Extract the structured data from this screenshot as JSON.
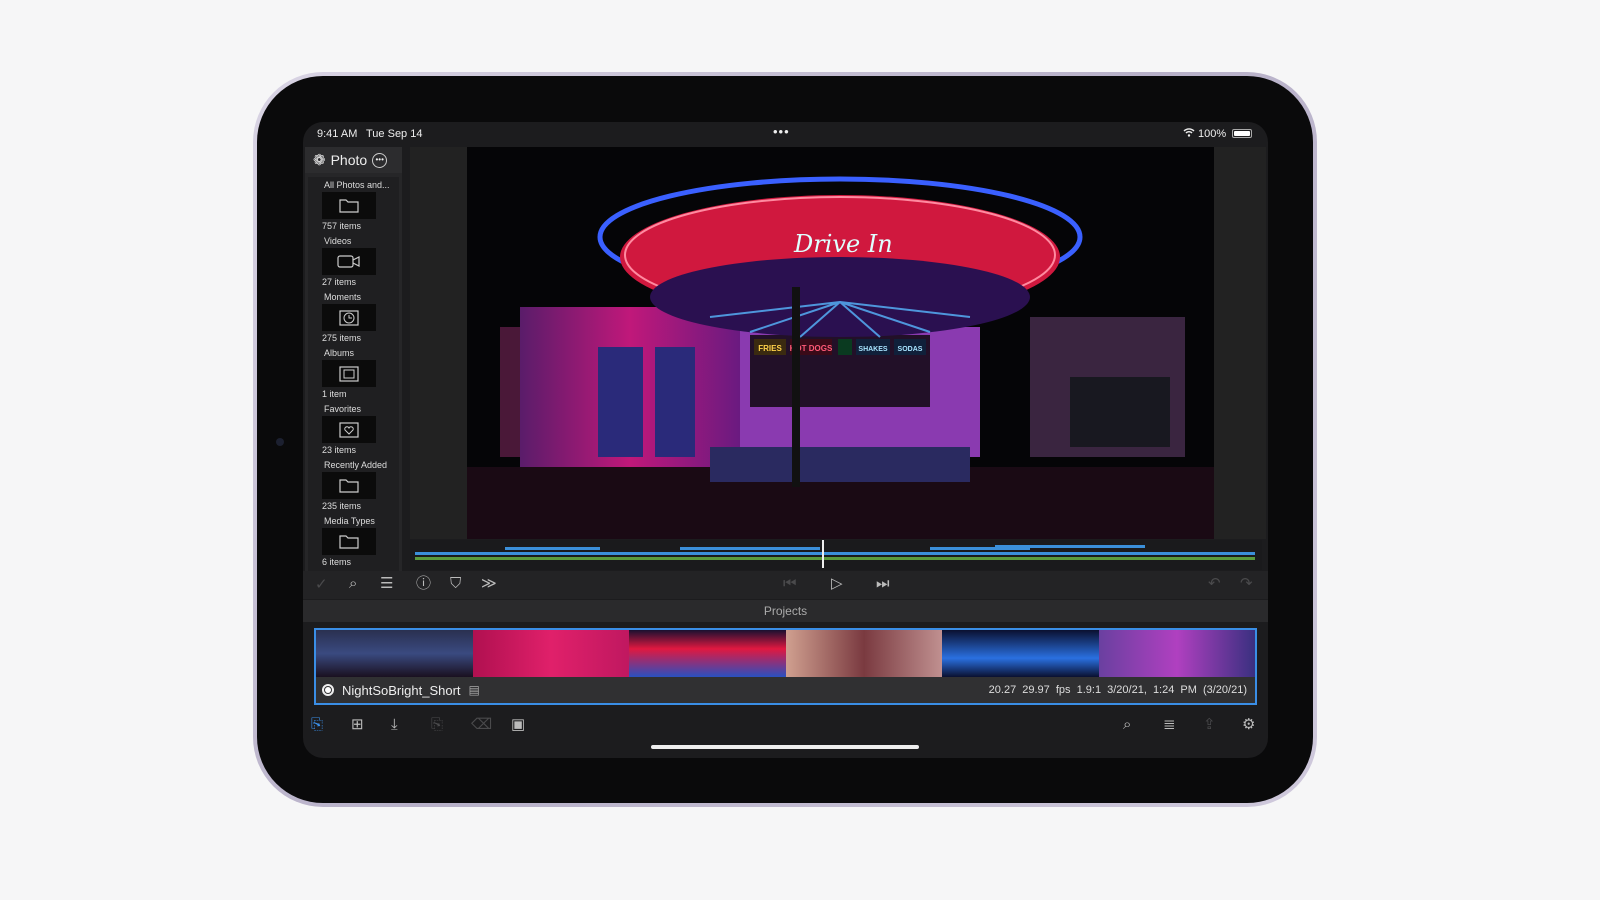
{
  "status_bar": {
    "time": "9:41 AM",
    "date": "Tue Sep 14",
    "battery": "100%",
    "multitask": "•••"
  },
  "sidebar": {
    "title": "Photo",
    "items": [
      {
        "label": "All Photos and...",
        "count": "757 items",
        "icon": "folder-icon"
      },
      {
        "label": "Videos",
        "count": "27 items",
        "icon": "video-camera-icon"
      },
      {
        "label": "Moments",
        "count": "275 items",
        "icon": "clock-icon"
      },
      {
        "label": "Albums",
        "count": "1 item",
        "icon": "album-icon"
      },
      {
        "label": "Favorites",
        "count": "23 items",
        "icon": "heart-icon"
      },
      {
        "label": "Recently Added",
        "count": "235 items",
        "icon": "folder-icon"
      },
      {
        "label": "Media Types",
        "count": "6 items",
        "icon": "folder-icon"
      }
    ]
  },
  "viewer": {
    "sign_text": "Drive In",
    "signs": [
      "FRIES",
      "HOT DOGS",
      "SHAKES",
      "SODAS"
    ]
  },
  "projects": {
    "header": "Projects",
    "project": {
      "name": "NightSoBright_Short",
      "duration": "20.27",
      "fps": "29.97 fps",
      "aspect": "1.9:1",
      "modified": "3/20/21, 1:24 PM",
      "created": "(3/20/21)"
    }
  },
  "colors": {
    "accent": "#3a8ee6",
    "track_blue": "#3b8fd9",
    "track_green": "#5a9a3c"
  }
}
